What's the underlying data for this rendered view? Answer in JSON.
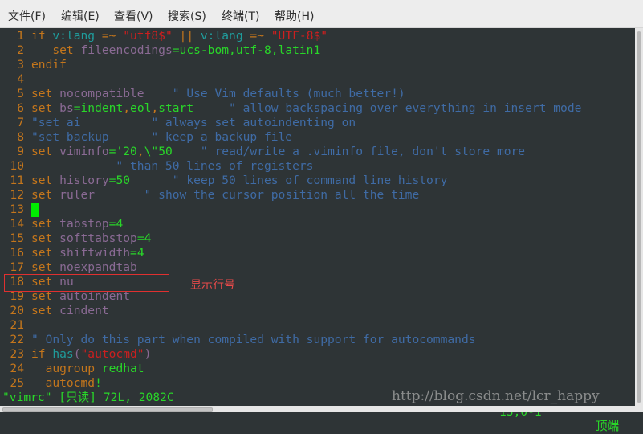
{
  "menubar": {
    "items": [
      "文件(F)",
      "编辑(E)",
      "查看(V)",
      "搜索(S)",
      "终端(T)",
      "帮助(H)"
    ]
  },
  "editor": {
    "lines": [
      {
        "n": "1",
        "tokens": [
          [
            "kw",
            "if "
          ],
          [
            "var",
            "v:lang "
          ],
          [
            "kw",
            "=~ "
          ],
          [
            "str",
            "\"utf8$\" "
          ],
          [
            "kw",
            "|| "
          ],
          [
            "var",
            "v:lang "
          ],
          [
            "kw",
            "=~ "
          ],
          [
            "str",
            "\"UTF-8$\""
          ]
        ]
      },
      {
        "n": "2",
        "tokens": [
          [
            "kw",
            "   set "
          ],
          [
            "opt",
            "fileencodings"
          ],
          [
            "val",
            "=ucs-bom,utf-8,latin1"
          ]
        ]
      },
      {
        "n": "3",
        "tokens": [
          [
            "kw",
            "endif"
          ]
        ]
      },
      {
        "n": "4",
        "tokens": []
      },
      {
        "n": "5",
        "tokens": [
          [
            "kw",
            "set "
          ],
          [
            "opt",
            "nocompatible    "
          ],
          [
            "cmt",
            "\" Use Vim defaults (much better!)"
          ]
        ]
      },
      {
        "n": "6",
        "tokens": [
          [
            "kw",
            "set "
          ],
          [
            "opt",
            "bs"
          ],
          [
            "val",
            "=indent"
          ],
          [
            "kw",
            ","
          ],
          [
            "val",
            "eol"
          ],
          [
            "kw",
            ","
          ],
          [
            "val",
            "start     "
          ],
          [
            "cmt",
            "\" allow backspacing over everything in insert mode"
          ]
        ]
      },
      {
        "n": "7",
        "tokens": [
          [
            "cmt",
            "\"set ai          \" always set autoindenting on"
          ]
        ]
      },
      {
        "n": "8",
        "tokens": [
          [
            "cmt",
            "\"set backup      \" keep a backup file"
          ]
        ]
      },
      {
        "n": "9",
        "tokens": [
          [
            "kw",
            "set "
          ],
          [
            "opt",
            "viminfo"
          ],
          [
            "val",
            "='20"
          ],
          [
            "kw",
            ","
          ],
          [
            "val",
            "\\\"50    "
          ],
          [
            "cmt",
            "\" read/write a .viminfo file, don't store more"
          ]
        ]
      },
      {
        "n": "10",
        "tokens": [
          [
            "cmt",
            "            \" than 50 lines of registers"
          ]
        ]
      },
      {
        "n": "11",
        "tokens": [
          [
            "kw",
            "set "
          ],
          [
            "opt",
            "history"
          ],
          [
            "val",
            "=50      "
          ],
          [
            "cmt",
            "\" keep 50 lines of command line history"
          ]
        ]
      },
      {
        "n": "12",
        "tokens": [
          [
            "kw",
            "set "
          ],
          [
            "opt",
            "ruler       "
          ],
          [
            "cmt",
            "\" show the cursor position all the time"
          ]
        ]
      },
      {
        "n": "13",
        "tokens": [],
        "cursor": true
      },
      {
        "n": "14",
        "tokens": [
          [
            "kw",
            "set "
          ],
          [
            "opt",
            "tabstop"
          ],
          [
            "val",
            "=4"
          ]
        ]
      },
      {
        "n": "15",
        "tokens": [
          [
            "kw",
            "set "
          ],
          [
            "opt",
            "softtabstop"
          ],
          [
            "val",
            "=4"
          ]
        ]
      },
      {
        "n": "16",
        "tokens": [
          [
            "kw",
            "set "
          ],
          [
            "opt",
            "shiftwidth"
          ],
          [
            "val",
            "=4"
          ]
        ]
      },
      {
        "n": "17",
        "tokens": [
          [
            "kw",
            "set "
          ],
          [
            "opt",
            "noexpandtab"
          ]
        ]
      },
      {
        "n": "18",
        "tokens": [
          [
            "kw",
            "set "
          ],
          [
            "opt",
            "nu"
          ]
        ]
      },
      {
        "n": "19",
        "tokens": [
          [
            "kw",
            "set "
          ],
          [
            "opt",
            "autoindent"
          ]
        ]
      },
      {
        "n": "20",
        "tokens": [
          [
            "kw",
            "set "
          ],
          [
            "opt",
            "cindent"
          ]
        ]
      },
      {
        "n": "21",
        "tokens": []
      },
      {
        "n": "22",
        "tokens": [
          [
            "cmt",
            "\" Only do this part when compiled with support for autocommands"
          ]
        ]
      },
      {
        "n": "23",
        "tokens": [
          [
            "kw",
            "if "
          ],
          [
            "var",
            "has"
          ],
          [
            "dflt",
            "("
          ],
          [
            "str",
            "\"autocmd\""
          ],
          [
            "dflt",
            ")"
          ]
        ]
      },
      {
        "n": "24",
        "tokens": [
          [
            "kw",
            "  augroup "
          ],
          [
            "val",
            "redhat"
          ]
        ]
      },
      {
        "n": "25",
        "tokens": [
          [
            "kw",
            "  autocmd"
          ],
          [
            "val",
            "!"
          ]
        ]
      }
    ]
  },
  "statusline": {
    "file_info": "\"vimrc\" [只读] 72L, 2082C",
    "cursor_position": "13,0-1",
    "scroll_position": "顶端"
  },
  "annotation": {
    "label": "显示行号",
    "highlighted_line": "18"
  },
  "watermark": "http://blog.csdn.net/lcr_happy",
  "colors": {
    "background": "#2e3436",
    "line_number": "#c4761c",
    "keyword": "#c4761c",
    "option": "#8a6a94",
    "value": "#29d629",
    "string": "#cc1f1f",
    "comment": "#3f6ba5",
    "cursor": "#00ee00",
    "annotation": "#e03030"
  }
}
